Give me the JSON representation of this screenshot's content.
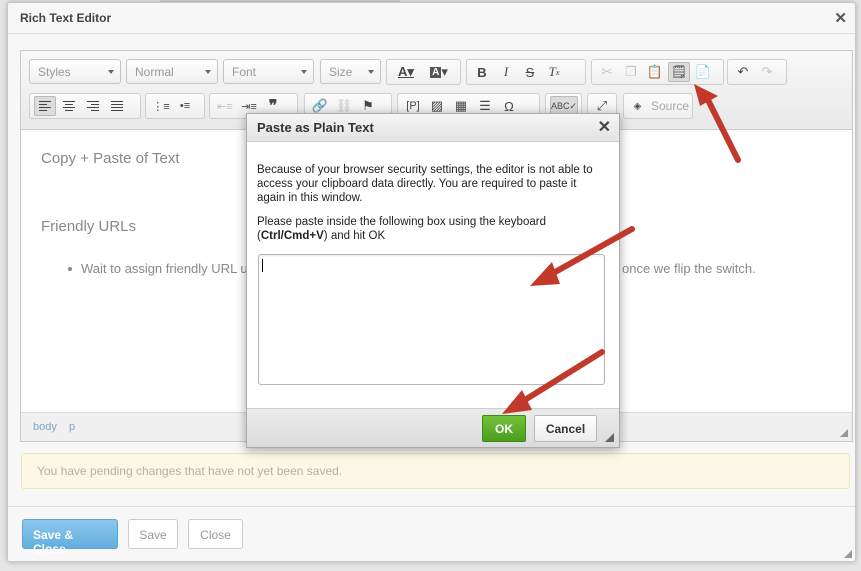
{
  "modal": {
    "title": "Rich Text Editor",
    "close_icon": "close-icon"
  },
  "toolbar": {
    "combos": [
      {
        "label": "Styles"
      },
      {
        "label": "Normal"
      },
      {
        "label": "Font"
      },
      {
        "label": "Size"
      }
    ],
    "source_label": "Source"
  },
  "content": {
    "heading1": "Copy + Paste of Text",
    "heading2": "Friendly URLs",
    "bullet_start": "Wait to assign friendly URL u",
    "bullet_end": "once we flip the switch."
  },
  "element_path": [
    "body",
    "p"
  ],
  "pending_message": "You have pending changes that have not yet been saved.",
  "footer": {
    "save_close": "Save & Close",
    "save": "Save",
    "close": "Close"
  },
  "dialog": {
    "title": "Paste as Plain Text",
    "text1": "Because of your browser security settings, the editor is not able to access your clipboard data directly. You are required to paste it again in this window.",
    "text2_before": "Please paste inside the following box using the keyboard (",
    "text2_keys": "Ctrl/Cmd+V",
    "text2_after": ") and hit OK",
    "ok": "OK",
    "cancel": "Cancel",
    "textarea_value": ""
  },
  "colors": {
    "accent": "#62aede",
    "ok_green": "#4d9d1f",
    "annotation_arrow": "#c0392b"
  }
}
